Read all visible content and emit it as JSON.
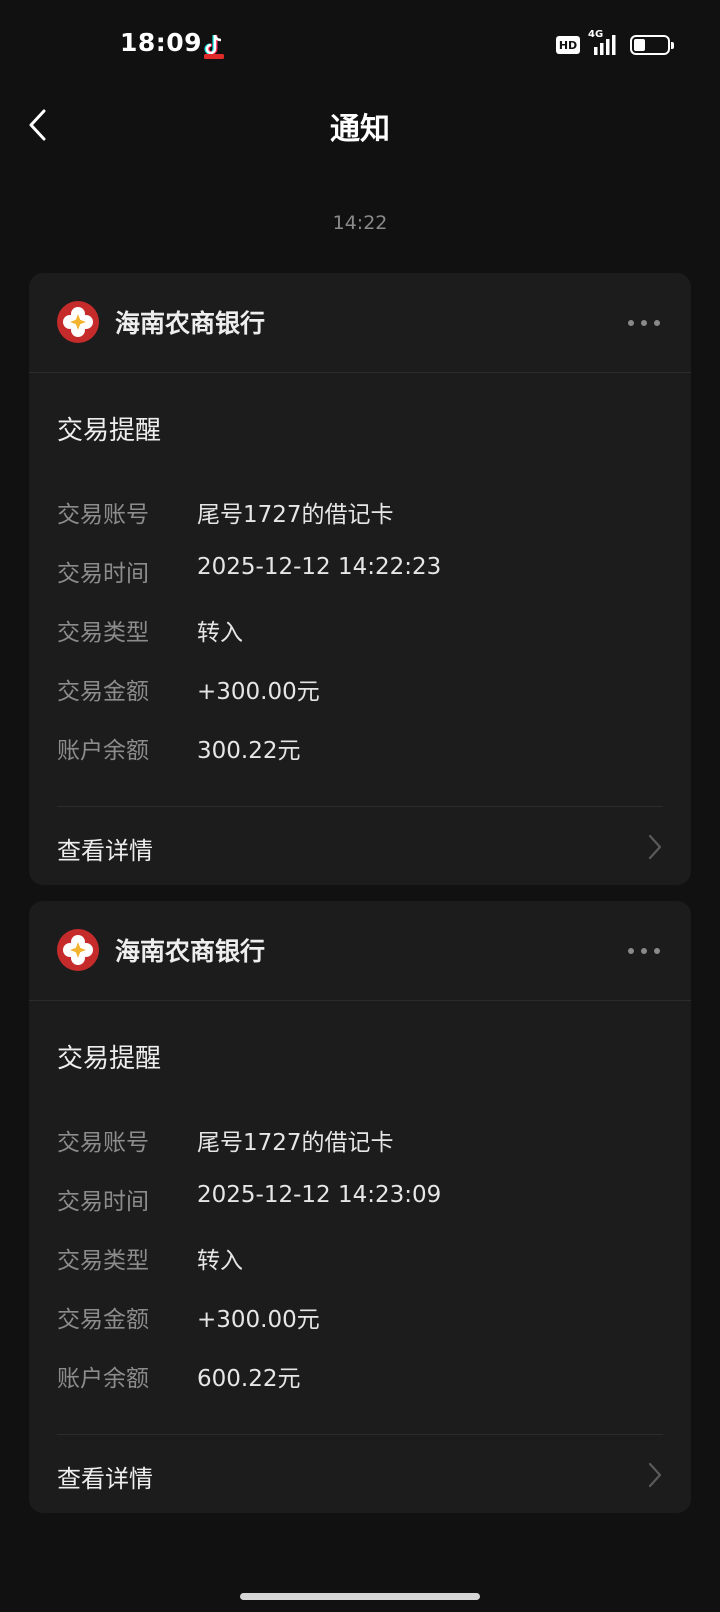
{
  "status_bar": {
    "time": "18:09",
    "hd_label": "HD",
    "network_label": "4G",
    "battery_level": 0.35
  },
  "header": {
    "title": "通知"
  },
  "timestamp": "14:22",
  "colors": {
    "background": "#111111",
    "card": "#1c1c1c",
    "logo_red": "#c62b2b",
    "logo_gold": "#f2b32e"
  },
  "notifications": [
    {
      "bank_name": "海南农商银行",
      "title": "交易提醒",
      "fields": [
        {
          "label": "交易账号",
          "value": "尾号1727的借记卡"
        },
        {
          "label": "交易时间",
          "value": "2025-12-12 14:22:23"
        },
        {
          "label": "交易类型",
          "value": "转入"
        },
        {
          "label": "交易金额",
          "value": "+300.00元"
        },
        {
          "label": "账户余额",
          "value": "300.22元"
        }
      ],
      "action_label": "查看详情"
    },
    {
      "bank_name": "海南农商银行",
      "title": "交易提醒",
      "fields": [
        {
          "label": "交易账号",
          "value": "尾号1727的借记卡"
        },
        {
          "label": "交易时间",
          "value": "2025-12-12 14:23:09"
        },
        {
          "label": "交易类型",
          "value": "转入"
        },
        {
          "label": "交易金额",
          "value": "+300.00元"
        },
        {
          "label": "账户余额",
          "value": "600.22元"
        }
      ],
      "action_label": "查看详情"
    }
  ]
}
